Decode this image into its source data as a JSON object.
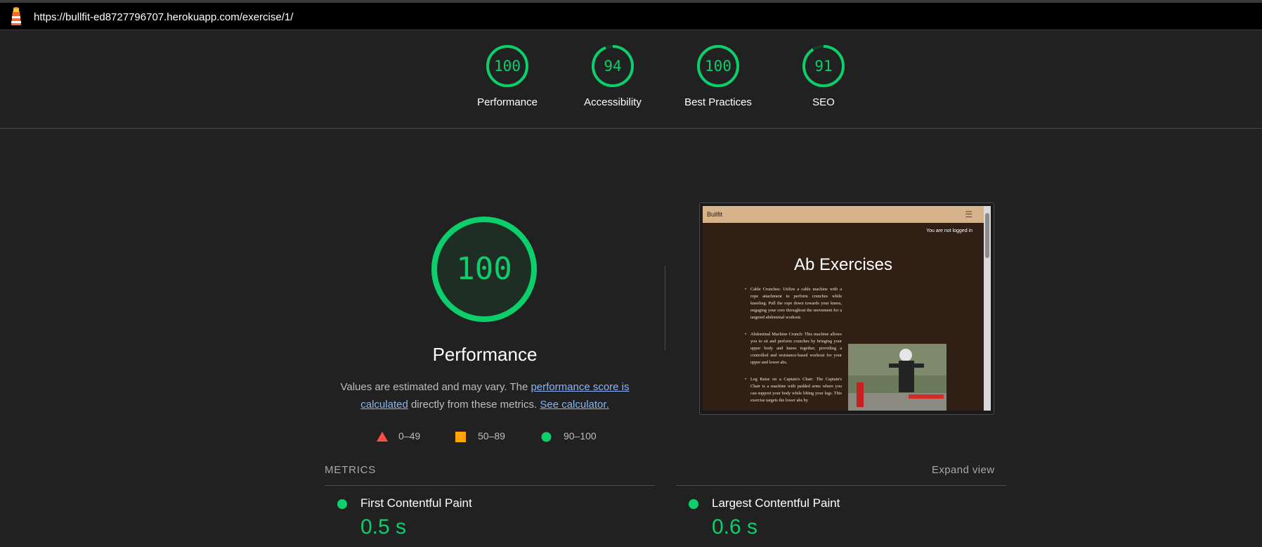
{
  "topbar": {
    "url": "https://bullfit-ed8727796707.herokuapp.com/exercise/1/"
  },
  "scores": [
    {
      "value": "100",
      "label": "Performance",
      "fraction": 1.0
    },
    {
      "value": "94",
      "label": "Accessibility",
      "fraction": 0.94
    },
    {
      "value": "100",
      "label": "Best Practices",
      "fraction": 1.0
    },
    {
      "value": "91",
      "label": "SEO",
      "fraction": 0.91
    }
  ],
  "performance": {
    "score": "100",
    "title": "Performance",
    "desc_prefix": "Values are estimated and may vary. The ",
    "link_score": "performance score is calculated",
    "desc_mid": " directly from these metrics. ",
    "link_calculator": "See calculator."
  },
  "legend": [
    {
      "range": "0–49",
      "color": "#ff4e42"
    },
    {
      "range": "50–89",
      "color": "#ffa400"
    },
    {
      "range": "90–100",
      "color": "#0cce6b"
    }
  ],
  "screenshot": {
    "brand": "Bullfit",
    "menu_icon": "hamburger-icon",
    "login_status": "You are not logged in",
    "heading": "Ab Exercises",
    "items": [
      "Cable Crunches: Utilize a cable machine with a rope attachment to perform crunches while kneeling. Pull the rope down towards your knees, engaging your core throughout the movement for a targeted abdominal workout.",
      "Abdominal Machine Crunch: This machine allows you to sit and perform crunches by bringing your upper body and knees together, providing a controlled and resistance-based workout for your upper and lower abs.",
      "Leg Raise on a Captain's Chair: The Captain's Chair is a machine with padded arms where you can support your body while lifting your legs. This exercise targets the lower abs by"
    ]
  },
  "metrics": {
    "header": "METRICS",
    "expand_label": "Expand view",
    "items": [
      {
        "name": "First Contentful Paint",
        "value": "0.5 s"
      },
      {
        "name": "Largest Contentful Paint",
        "value": "0.6 s"
      }
    ]
  },
  "colors": {
    "pass": "#0cce6b",
    "fail": "#ff4e42",
    "average": "#ffa400",
    "link": "#8ab4f8"
  }
}
